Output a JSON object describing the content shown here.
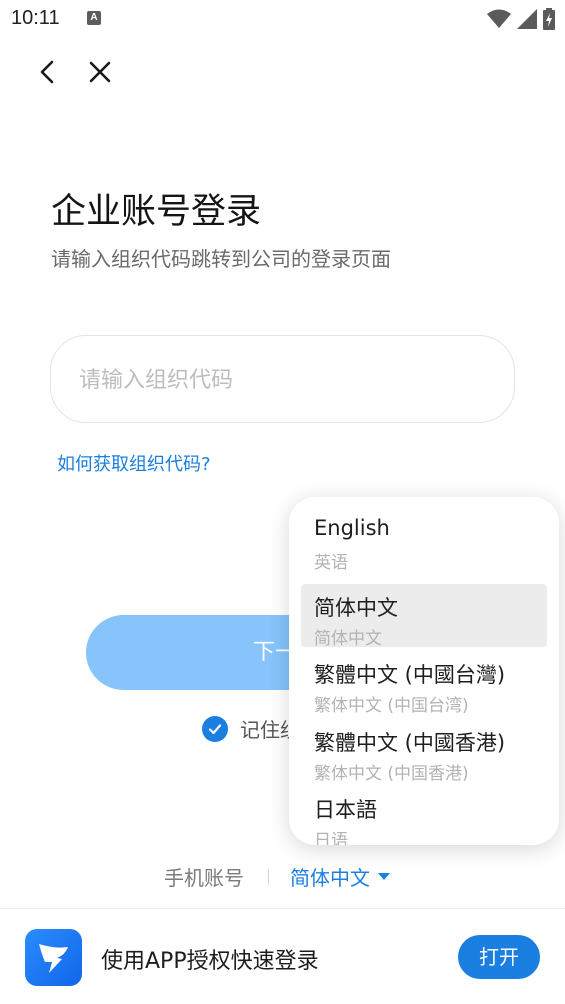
{
  "status_bar": {
    "time": "10:11",
    "notification_icon": "a-box-icon",
    "icons": [
      "wifi-icon",
      "signal-icon",
      "battery-charging-icon"
    ]
  },
  "nav": {
    "back_icon": "chevron-left-icon",
    "close_icon": "close-icon"
  },
  "header": {
    "title": "企业账号登录",
    "subtitle": "请输入组织代码跳转到公司的登录页面"
  },
  "org_code": {
    "placeholder": "请输入组织代码",
    "value": ""
  },
  "help_link": "如何获取组织代码?",
  "next_button": "下一步",
  "remember": {
    "checked": true,
    "label": "记住组织代码"
  },
  "bottom_switch": {
    "phone_login": "手机账号",
    "language": "简体中文"
  },
  "language_menu": {
    "items": [
      {
        "native": "English",
        "local": "英语",
        "selected": false
      },
      {
        "native": "简体中文",
        "local": "简体中文",
        "selected": true
      },
      {
        "native": "繁體中文 (中國台灣)",
        "local": "繁体中文 (中国台湾)",
        "selected": false
      },
      {
        "native": "繁體中文 (中國香港)",
        "local": "繁体中文 (中国香港)",
        "selected": false
      },
      {
        "native": "日本語",
        "local": "日语",
        "selected": false
      }
    ]
  },
  "app_bar": {
    "text": "使用APP授权快速登录",
    "open_button": "打开",
    "logo_icon": "dingtalk-logo-icon"
  },
  "colors": {
    "accent": "#1a7fe0",
    "button_disabled": "#86c4fb"
  }
}
